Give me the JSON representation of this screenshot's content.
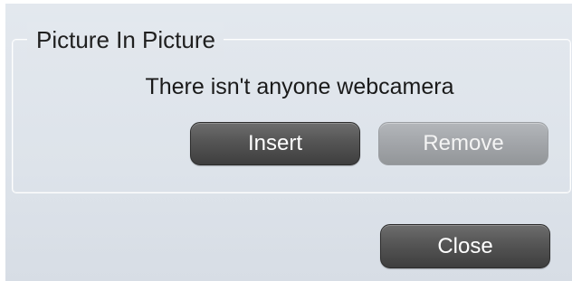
{
  "dialog": {
    "group_title": "Picture In Picture",
    "message": "There isn't anyone webcamera",
    "insert_label": "Insert",
    "remove_label": "Remove",
    "close_label": "Close"
  },
  "colors": {
    "dialog_background": "#dde3ea",
    "button_dark": "#555555",
    "button_disabled": "#a2a5a9",
    "button_text": "#ffffff"
  },
  "state": {
    "remove_enabled": false
  }
}
